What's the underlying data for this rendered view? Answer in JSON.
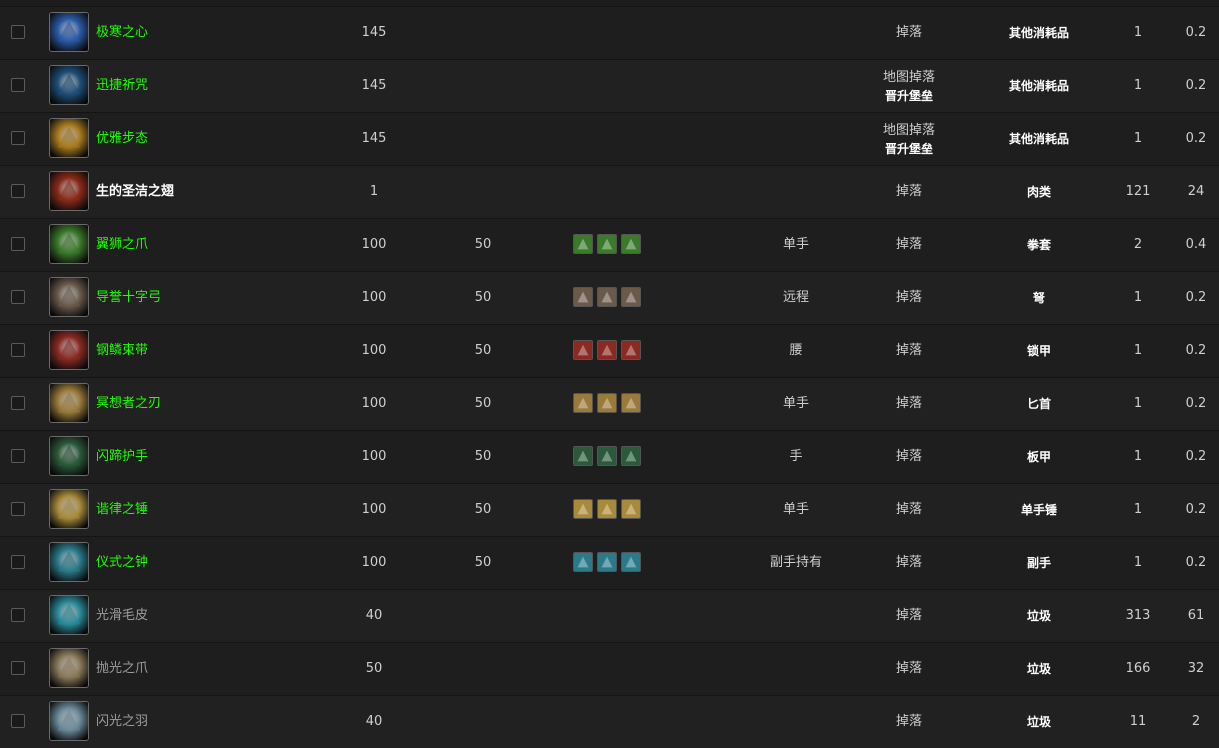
{
  "rows": [
    {
      "name": "极寒之心",
      "quality": "green",
      "level": "145",
      "req": "",
      "gems": 0,
      "slot": "",
      "source": "掉落",
      "source_sub": "",
      "type": "其他消耗品",
      "stack": "1",
      "price": "0.2",
      "icon": "frost-heart-icon",
      "icolor": "#2a5aa8"
    },
    {
      "name": "迅捷祈咒",
      "quality": "green",
      "level": "145",
      "req": "",
      "gems": 0,
      "slot": "",
      "source": "地图掉落",
      "source_sub": "晋升堡垒",
      "type": "其他消耗品",
      "stack": "1",
      "price": "0.2",
      "icon": "swift-incantation-icon",
      "icolor": "#1f4e78"
    },
    {
      "name": "优雅步态",
      "quality": "green",
      "level": "145",
      "req": "",
      "gems": 0,
      "slot": "",
      "source": "地图掉落",
      "source_sub": "晋升堡垒",
      "type": "其他消耗品",
      "stack": "1",
      "price": "0.2",
      "icon": "graceful-stride-icon",
      "icolor": "#a87a1e"
    },
    {
      "name": "生的圣洁之翅",
      "quality": "white",
      "level": "1",
      "req": "",
      "gems": 0,
      "slot": "",
      "source": "掉落",
      "source_sub": "",
      "type": "肉类",
      "stack": "121",
      "price": "24",
      "icon": "raw-wing-icon",
      "icolor": "#8a2a18"
    },
    {
      "name": "翼狮之爪",
      "quality": "green",
      "level": "100",
      "req": "50",
      "gems": 3,
      "slot": "单手",
      "source": "掉落",
      "source_sub": "",
      "type": "拳套",
      "stack": "2",
      "price": "0.4",
      "icon": "gryphon-claw-icon",
      "icolor": "#3a7a2a"
    },
    {
      "name": "导誉十字弓",
      "quality": "green",
      "level": "100",
      "req": "50",
      "gems": 3,
      "slot": "远程",
      "source": "掉落",
      "source_sub": "",
      "type": "弩",
      "stack": "1",
      "price": "0.2",
      "icon": "crossbow-icon",
      "icolor": "#6a5a4a"
    },
    {
      "name": "钢鳞束带",
      "quality": "green",
      "level": "100",
      "req": "50",
      "gems": 3,
      "slot": "腰",
      "source": "掉落",
      "source_sub": "",
      "type": "锁甲",
      "stack": "1",
      "price": "0.2",
      "icon": "belt-icon",
      "icolor": "#8a2a22"
    },
    {
      "name": "冥想者之刃",
      "quality": "green",
      "level": "100",
      "req": "50",
      "gems": 3,
      "slot": "单手",
      "source": "掉落",
      "source_sub": "",
      "type": "匕首",
      "stack": "1",
      "price": "0.2",
      "icon": "dagger-icon",
      "icolor": "#9a7a3a"
    },
    {
      "name": "闪蹄护手",
      "quality": "green",
      "level": "100",
      "req": "50",
      "gems": 3,
      "slot": "手",
      "source": "掉落",
      "source_sub": "",
      "type": "板甲",
      "stack": "1",
      "price": "0.2",
      "icon": "gauntlet-icon",
      "icolor": "#2a5a3a"
    },
    {
      "name": "谐律之锤",
      "quality": "green",
      "level": "100",
      "req": "50",
      "gems": 3,
      "slot": "单手",
      "source": "掉落",
      "source_sub": "",
      "type": "单手锤",
      "stack": "1",
      "price": "0.2",
      "icon": "mace-icon",
      "icolor": "#a88a3a"
    },
    {
      "name": "仪式之钟",
      "quality": "green",
      "level": "100",
      "req": "50",
      "gems": 3,
      "slot": "副手持有",
      "source": "掉落",
      "source_sub": "",
      "type": "副手",
      "stack": "1",
      "price": "0.2",
      "icon": "bell-icon",
      "icolor": "#2a7a8a"
    },
    {
      "name": "光滑毛皮",
      "quality": "gray",
      "level": "40",
      "req": "",
      "gems": 0,
      "slot": "",
      "source": "掉落",
      "source_sub": "",
      "type": "垃圾",
      "stack": "313",
      "price": "61",
      "icon": "pelt-icon",
      "icolor": "#2a8a9a"
    },
    {
      "name": "抛光之爪",
      "quality": "gray",
      "level": "50",
      "req": "",
      "gems": 0,
      "slot": "",
      "source": "掉落",
      "source_sub": "",
      "type": "垃圾",
      "stack": "166",
      "price": "32",
      "icon": "claw-icon",
      "icolor": "#8a7a5a"
    },
    {
      "name": "闪光之羽",
      "quality": "gray",
      "level": "40",
      "req": "",
      "gems": 0,
      "slot": "",
      "source": "掉落",
      "source_sub": "",
      "type": "垃圾",
      "stack": "11",
      "price": "2",
      "icon": "feather-icon",
      "icolor": "#6a8a9a"
    }
  ]
}
